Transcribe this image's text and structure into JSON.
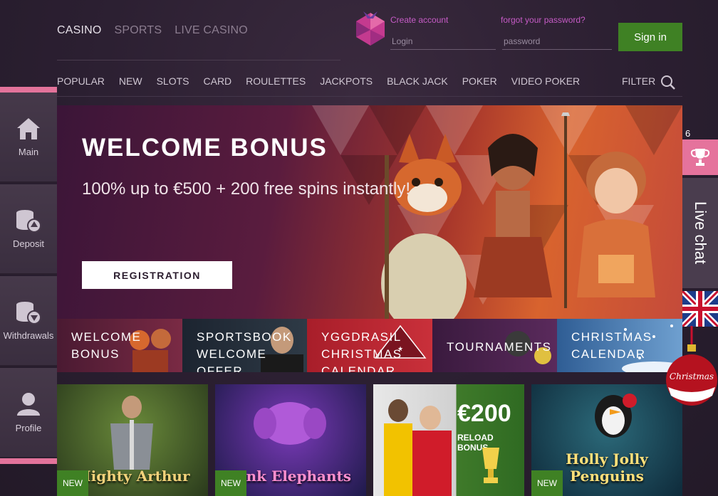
{
  "product_tabs": [
    {
      "label": "CASINO",
      "active": true
    },
    {
      "label": "SPORTS",
      "active": false
    },
    {
      "label": "LIVE CASINO",
      "active": false
    }
  ],
  "auth": {
    "create_account": "Create account",
    "forgot_password": "forgot your password?",
    "login_placeholder": "Login",
    "password_placeholder": "password",
    "sign_in": "Sign in"
  },
  "categories": [
    "POPULAR",
    "NEW",
    "SLOTS",
    "CARD",
    "ROULETTES",
    "JACKPOTS",
    "BLACK JACK",
    "POKER",
    "VIDEO POKER"
  ],
  "filter_label": "FILTER",
  "sidebar": [
    {
      "label": "Main",
      "icon": "home-icon"
    },
    {
      "label": "Deposit",
      "icon": "coins-up-icon"
    },
    {
      "label": "Withdrawals",
      "icon": "coins-down-icon"
    },
    {
      "label": "Profile",
      "icon": "user-icon"
    }
  ],
  "hero": {
    "title": "WELCOME BONUS",
    "subtitle": "100% up to €500 + 200 free spins instantly!",
    "cta": "REGISTRATION"
  },
  "promos": [
    {
      "label": "WELCOME BONUS",
      "color": "#6a1f3d"
    },
    {
      "label": "SPORTSBOOK WELCOME OFFER",
      "color": "#1e2a36"
    },
    {
      "label": "YGGDRASIL CHRISTMAS CALENDAR",
      "color": "#b5232e"
    },
    {
      "label": "TOURNAMENTS",
      "color": "#5a2a5c"
    },
    {
      "label": "CHRISTMAS CALENDAR",
      "color": "#3f6fa8"
    }
  ],
  "games": [
    {
      "name": "Mighty Arthur",
      "badge": "NEW",
      "bg": "#3e5a2c"
    },
    {
      "name": "Pink Elephants",
      "badge": "NEW",
      "bg": "#3a2a74"
    },
    {
      "name": "",
      "badge": "",
      "bg": "#d9d9d9",
      "promo_amount": "€200",
      "promo_text": "RELOAD BONUS"
    },
    {
      "name": "Holly Jolly Penguins",
      "badge": "NEW",
      "bg": "#1f4a66"
    }
  ],
  "trophy_count": "6",
  "live_chat": "Live chat",
  "xmas_label": "Christmas",
  "colors": {
    "accent_pink": "#e5739c",
    "brand_green": "#3f8124",
    "sidebar": "#46394a"
  }
}
